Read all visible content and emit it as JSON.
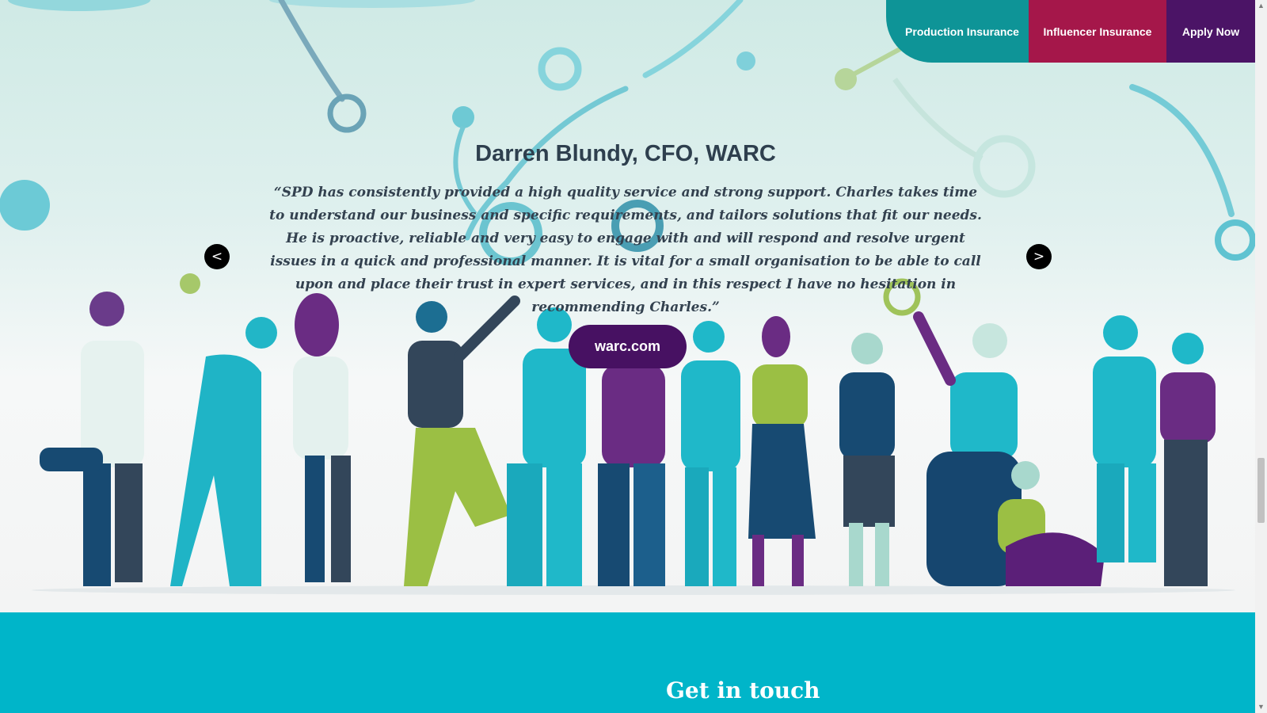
{
  "nav": {
    "production_insurance": "Production Insurance",
    "influencer_insurance": "Influencer Insurance",
    "apply_now": "Apply Now"
  },
  "testimonial": {
    "name": "Darren Blundy, CFO, WARC",
    "quote": "“SPD has consistently provided a high quality service and strong support. Charles takes time to understand our business and specific requirements, and tailors solutions that fit our needs. He is proactive, reliable and very easy to engage with and will respond and resolve urgent issues in a quick and professional manner. It is vital for a small organisation to be able to call upon and place their trust in expert services, and in this respect I have no hesitation in recommending Charles.”",
    "link_label": "warc.com",
    "prev_label": "<",
    "next_label": ">"
  },
  "contact": {
    "heading": "Get in touch"
  },
  "scrollbar": {
    "up_glyph": "▲",
    "down_glyph": "▼"
  },
  "colors": {
    "teal": "#0e9497",
    "crimson": "#a5174a",
    "purple": "#4b1466",
    "button_purple": "#471162",
    "contact_bg": "#00b5c9",
    "people_teal": "#1fb8c9",
    "people_navy": "#16466f",
    "people_lime": "#9bbf44"
  },
  "icons": {
    "prev": "chevron-left-icon",
    "next": "chevron-right-icon"
  }
}
